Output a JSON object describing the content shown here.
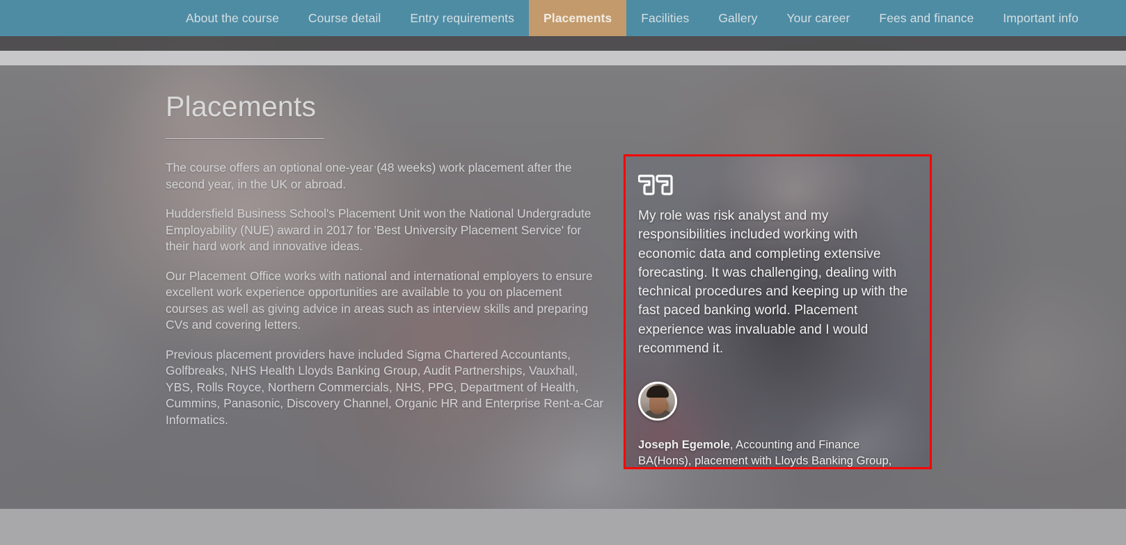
{
  "nav": {
    "items": [
      {
        "label": "About the course",
        "active": false
      },
      {
        "label": "Course detail",
        "active": false
      },
      {
        "label": "Entry requirements",
        "active": false
      },
      {
        "label": "Placements",
        "active": true
      },
      {
        "label": "Facilities",
        "active": false
      },
      {
        "label": "Gallery",
        "active": false
      },
      {
        "label": "Your career",
        "active": false
      },
      {
        "label": "Fees and finance",
        "active": false
      },
      {
        "label": "Important info",
        "active": false
      }
    ],
    "active_background": "#c39a6b",
    "background": "#4e8ca4"
  },
  "main": {
    "title": "Placements",
    "paragraphs": [
      "The course offers an optional one-year (48 weeks) work placement after the second year, in the UK or abroad.",
      "Huddersfield Business School's Placement Unit won the National Undergradute Employability (NUE) award in 2017 for 'Best University Placement Service' for their hard work and innovative ideas.",
      "Our Placement Office works with national and international employers to ensure excellent work experience opportunities are available to you on placement courses as well as giving advice in areas such as interview skills and preparing CVs and covering letters.",
      "Previous placement providers have included Sigma Chartered Accountants, Golfbreaks, NHS Health Lloyds Banking Group, Audit Partnerships, Vauxhall, YBS, Rolls Royce, Northern Commercials, NHS, PPG, Department of Health, Cummins, Panasonic, Discovery Channel, Organic HR and Enterprise Rent-a-Car Informatics."
    ]
  },
  "testimonial": {
    "quote_icon": "double-quote-icon",
    "quote": "My role was risk analyst and my responsibilities included working with economic data and completing extensive forecasting. It was challenging, dealing with technical procedures and keeping up with the fast paced banking world. Placement experience was invaluable and I would recommend it.",
    "attribution_name": "Joseph Egemole",
    "attribution_rest": ", Accounting and Finance BA(Hons), placement with Lloyds Banking Group, Halifax",
    "avatar_alt": "student-portrait",
    "highlight_border_color": "#ff0000"
  }
}
